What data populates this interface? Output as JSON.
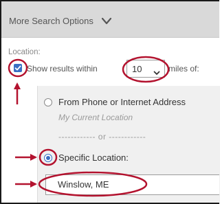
{
  "header": {
    "title": "More Search Options",
    "chevron_icon": "chevron-down-icon"
  },
  "location_label": "Location:",
  "distance": {
    "checked": true,
    "show_label": "Show results within",
    "miles_value": "10",
    "miles_label": "miles of:"
  },
  "options": {
    "from_phone_label": "From Phone or Internet Address",
    "current_location_text": "My Current Location",
    "or_separator": "------------ or ------------",
    "specific_label": "Specific Location:",
    "selected": "specific"
  },
  "location_input": {
    "value": "Winslow, ME"
  },
  "colors": {
    "accent": "#3a6fc4",
    "annotation": "#b3122e",
    "header_bg": "#d9d9d9",
    "panel_bg": "#f0f0f0"
  }
}
